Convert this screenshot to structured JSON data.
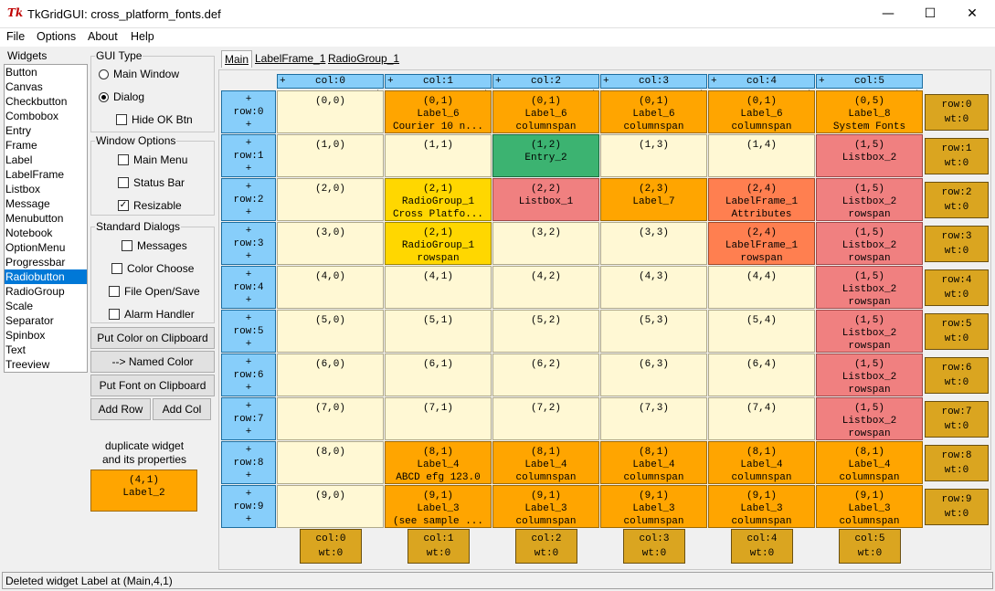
{
  "window": {
    "title": "TkGridGUI: cross_platform_fonts.def",
    "app_icon": "Tk",
    "minimize": "—",
    "maximize": "☐",
    "close": "✕"
  },
  "menu": [
    "File",
    "Options",
    "About",
    "Help"
  ],
  "widgets": {
    "legend": "Widgets",
    "items": [
      "Button",
      "Canvas",
      "Checkbutton",
      "Combobox",
      "Entry",
      "Frame",
      "Label",
      "LabelFrame",
      "Listbox",
      "Message",
      "Menubutton",
      "Notebook",
      "OptionMenu",
      "Progressbar",
      "Radiobutton",
      "RadioGroup",
      "Scale",
      "Separator",
      "Spinbox",
      "Text",
      "Treeview"
    ],
    "selected": "Radiobutton"
  },
  "gui_type": {
    "legend": "GUI Type",
    "main_window": "Main Window",
    "dialog": "Dialog",
    "hide_ok": "Hide OK Btn",
    "selected": "Dialog"
  },
  "window_options": {
    "legend": "Window Options",
    "main_menu": "Main Menu",
    "status_bar": "Status Bar",
    "resizable": "Resizable",
    "resizable_checked": true
  },
  "standard_dialogs": {
    "legend": "Standard Dialogs",
    "messages": "Messages",
    "color_choose": "Color Choose",
    "file_open_save": "File Open/Save",
    "alarm_handler": "Alarm Handler"
  },
  "buttons": {
    "put_color": "Put Color on Clipboard",
    "named_color": "--> Named Color",
    "put_font": "Put Font on Clipboard",
    "add_row": "Add Row",
    "add_col": "Add Col"
  },
  "duplicate": {
    "label1": "duplicate widget",
    "label2": "and its properties",
    "line1": "(4,1)",
    "line2": "Label_2"
  },
  "tabs": [
    "Main",
    "LabelFrame_1",
    "RadioGroup_1"
  ],
  "grid": {
    "col_headers": [
      "col:0",
      "col:1",
      "col:2",
      "col:3",
      "col:4",
      "col:5"
    ],
    "row_headers": [
      "row:0",
      "row:1",
      "row:2",
      "row:3",
      "row:4",
      "row:5",
      "row:6",
      "row:7",
      "row:8",
      "row:9"
    ],
    "plus": "+",
    "row_weights": [
      {
        "r": "row:0",
        "w": "wt:0"
      },
      {
        "r": "row:1",
        "w": "wt:0"
      },
      {
        "r": "row:2",
        "w": "wt:0"
      },
      {
        "r": "row:3",
        "w": "wt:0"
      },
      {
        "r": "row:4",
        "w": "wt:0"
      },
      {
        "r": "row:5",
        "w": "wt:0"
      },
      {
        "r": "row:6",
        "w": "wt:0"
      },
      {
        "r": "row:7",
        "w": "wt:0"
      },
      {
        "r": "row:8",
        "w": "wt:0"
      },
      {
        "r": "row:9",
        "w": "wt:0"
      }
    ],
    "col_weights": [
      {
        "c": "col:0",
        "w": "wt:0"
      },
      {
        "c": "col:1",
        "w": "wt:0"
      },
      {
        "c": "col:2",
        "w": "wt:0"
      },
      {
        "c": "col:3",
        "w": "wt:0"
      },
      {
        "c": "col:4",
        "w": "wt:0"
      },
      {
        "c": "col:5",
        "w": "wt:0"
      }
    ],
    "cells": [
      [
        {
          "t": [
            "(0,0)"
          ],
          "c": "empty"
        },
        {
          "t": [
            "(0,1)",
            "Label_6",
            "Courier 10 n..."
          ],
          "c": "orange"
        },
        {
          "t": [
            "(0,1)",
            "Label_6",
            "columnspan"
          ],
          "c": "orange"
        },
        {
          "t": [
            "(0,1)",
            "Label_6",
            "columnspan"
          ],
          "c": "orange"
        },
        {
          "t": [
            "(0,1)",
            "Label_6",
            "columnspan"
          ],
          "c": "orange"
        },
        {
          "t": [
            "(0,5)",
            "Label_8",
            "System Fonts"
          ],
          "c": "orange"
        }
      ],
      [
        {
          "t": [
            "(1,0)"
          ],
          "c": "empty"
        },
        {
          "t": [
            "(1,1)"
          ],
          "c": "empty"
        },
        {
          "t": [
            "(1,2)",
            "Entry_2"
          ],
          "c": "green"
        },
        {
          "t": [
            "(1,3)"
          ],
          "c": "empty"
        },
        {
          "t": [
            "(1,4)"
          ],
          "c": "empty"
        },
        {
          "t": [
            "(1,5)",
            "Listbox_2"
          ],
          "c": "red"
        }
      ],
      [
        {
          "t": [
            "(2,0)"
          ],
          "c": "empty"
        },
        {
          "t": [
            "(2,1)",
            "RadioGroup_1",
            "Cross Platfo..."
          ],
          "c": "yellow"
        },
        {
          "t": [
            "(2,2)",
            "Listbox_1"
          ],
          "c": "red"
        },
        {
          "t": [
            "(2,3)",
            "Label_7"
          ],
          "c": "orange"
        },
        {
          "t": [
            "(2,4)",
            "LabelFrame_1",
            "Attributes"
          ],
          "c": "coral"
        },
        {
          "t": [
            "(1,5)",
            "Listbox_2",
            "rowspan"
          ],
          "c": "red"
        }
      ],
      [
        {
          "t": [
            "(3,0)"
          ],
          "c": "empty"
        },
        {
          "t": [
            "(2,1)",
            "RadioGroup_1",
            "rowspan"
          ],
          "c": "yellow"
        },
        {
          "t": [
            "(3,2)"
          ],
          "c": "empty"
        },
        {
          "t": [
            "(3,3)"
          ],
          "c": "empty"
        },
        {
          "t": [
            "(2,4)",
            "LabelFrame_1",
            "rowspan"
          ],
          "c": "coral"
        },
        {
          "t": [
            "(1,5)",
            "Listbox_2",
            "rowspan"
          ],
          "c": "red"
        }
      ],
      [
        {
          "t": [
            "(4,0)"
          ],
          "c": "empty"
        },
        {
          "t": [
            "(4,1)"
          ],
          "c": "empty"
        },
        {
          "t": [
            "(4,2)"
          ],
          "c": "empty"
        },
        {
          "t": [
            "(4,3)"
          ],
          "c": "empty"
        },
        {
          "t": [
            "(4,4)"
          ],
          "c": "empty"
        },
        {
          "t": [
            "(1,5)",
            "Listbox_2",
            "rowspan"
          ],
          "c": "red"
        }
      ],
      [
        {
          "t": [
            "(5,0)"
          ],
          "c": "empty"
        },
        {
          "t": [
            "(5,1)"
          ],
          "c": "empty"
        },
        {
          "t": [
            "(5,2)"
          ],
          "c": "empty"
        },
        {
          "t": [
            "(5,3)"
          ],
          "c": "empty"
        },
        {
          "t": [
            "(5,4)"
          ],
          "c": "empty"
        },
        {
          "t": [
            "(1,5)",
            "Listbox_2",
            "rowspan"
          ],
          "c": "red"
        }
      ],
      [
        {
          "t": [
            "(6,0)"
          ],
          "c": "empty"
        },
        {
          "t": [
            "(6,1)"
          ],
          "c": "empty"
        },
        {
          "t": [
            "(6,2)"
          ],
          "c": "empty"
        },
        {
          "t": [
            "(6,3)"
          ],
          "c": "empty"
        },
        {
          "t": [
            "(6,4)"
          ],
          "c": "empty"
        },
        {
          "t": [
            "(1,5)",
            "Listbox_2",
            "rowspan"
          ],
          "c": "red"
        }
      ],
      [
        {
          "t": [
            "(7,0)"
          ],
          "c": "empty"
        },
        {
          "t": [
            "(7,1)"
          ],
          "c": "empty"
        },
        {
          "t": [
            "(7,2)"
          ],
          "c": "empty"
        },
        {
          "t": [
            "(7,3)"
          ],
          "c": "empty"
        },
        {
          "t": [
            "(7,4)"
          ],
          "c": "empty"
        },
        {
          "t": [
            "(1,5)",
            "Listbox_2",
            "rowspan"
          ],
          "c": "red"
        }
      ],
      [
        {
          "t": [
            "(8,0)"
          ],
          "c": "empty"
        },
        {
          "t": [
            "(8,1)",
            "Label_4",
            "ABCD efg 123.0"
          ],
          "c": "orange"
        },
        {
          "t": [
            "(8,1)",
            "Label_4",
            "columnspan"
          ],
          "c": "orange"
        },
        {
          "t": [
            "(8,1)",
            "Label_4",
            "columnspan"
          ],
          "c": "orange"
        },
        {
          "t": [
            "(8,1)",
            "Label_4",
            "columnspan"
          ],
          "c": "orange"
        },
        {
          "t": [
            "(8,1)",
            "Label_4",
            "columnspan"
          ],
          "c": "orange"
        }
      ],
      [
        {
          "t": [
            "(9,0)"
          ],
          "c": "empty"
        },
        {
          "t": [
            "(9,1)",
            "Label_3",
            "(see sample ..."
          ],
          "c": "orange"
        },
        {
          "t": [
            "(9,1)",
            "Label_3",
            "columnspan"
          ],
          "c": "orange"
        },
        {
          "t": [
            "(9,1)",
            "Label_3",
            "columnspan"
          ],
          "c": "orange"
        },
        {
          "t": [
            "(9,1)",
            "Label_3",
            "columnspan"
          ],
          "c": "orange"
        },
        {
          "t": [
            "(9,1)",
            "Label_3",
            "columnspan"
          ],
          "c": "orange"
        }
      ]
    ]
  },
  "status": "Deleted widget Label at (Main,4,1)"
}
